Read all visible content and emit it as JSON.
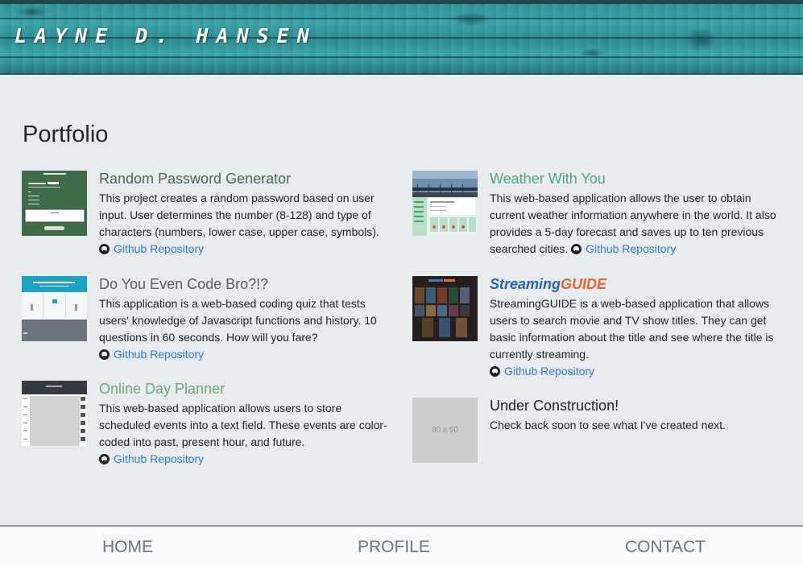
{
  "header": {
    "site_title": "LAYNE D. HANSEN"
  },
  "page": {
    "heading": "Portfolio"
  },
  "projects": [
    {
      "title": "Random Password Generator",
      "title_color": "#4a6b54",
      "description": "This project creates a random password based on user input. User determines the number (8-128) and type of characters (numbers, lower case, upper case, symbols).",
      "link_label": "Github Repository",
      "thumb_icon": "password-generator-thumbnail"
    },
    {
      "title": "Do You Even Code Bro?!?",
      "title_color": "#5c5c5c",
      "description": "This application is a web-based coding quiz that tests users' knowledge of Javascript functions and history. 10 questions in 60 seconds. How will you fare?",
      "link_label": "Github Repository",
      "thumb_icon": "coding-quiz-thumbnail"
    },
    {
      "title": "Online Day Planner",
      "title_color": "#6aa879",
      "description": "This web-based application allows users to store scheduled events into a text field. These events are color-coded into past, present hour, and future.",
      "link_label": "Github Repository",
      "thumb_icon": "day-planner-thumbnail"
    },
    {
      "title": "Weather With You",
      "title_color": "#4ea67f",
      "description": "This web-based application allows the user to obtain current weather information anywhere in the world. It also provides a 5-day forecast and saves up to ten previous searched cities.",
      "link_label": "Github Repository",
      "thumb_icon": "weather-app-thumbnail"
    },
    {
      "title_part1": "Streaming",
      "title_part2": "GUIDE",
      "title_color1": "#2266b3",
      "title_color2": "#e8652b",
      "description": "StreamingGUIDE is a web-based application that allows users to search movie and TV show titles. They can get basic information about the title and see where the title is currently streaming.",
      "link_label": "Github Repository",
      "thumb_icon": "streaming-guide-thumbnail"
    },
    {
      "title": "Under Construction!",
      "title_color": "#212529",
      "description": "Check back soon to see what I've created next.",
      "placeholder_text": "90 x 90",
      "thumb_icon": "placeholder-thumbnail"
    }
  ],
  "nav": {
    "home": "HOME",
    "profile": "PROFILE",
    "contact": "CONTACT"
  },
  "colors": {
    "link": "#2f7ad8",
    "background": "#e9ecef",
    "header_teal": "#3aa3a9"
  }
}
